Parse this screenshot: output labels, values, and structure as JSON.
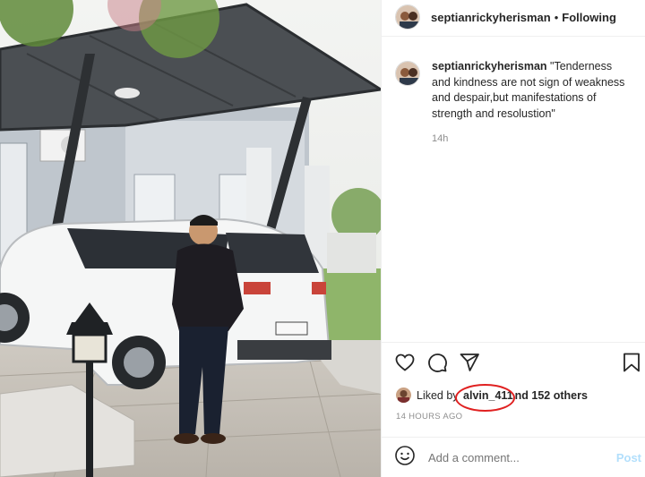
{
  "post": {
    "username": "septianrickyherisman",
    "separator": "•",
    "follow_status": "Following"
  },
  "caption": {
    "username": "septianrickyherisman",
    "text": "\"Tenderness and kindness are not sign of weakness and despair,but manifestations of strength and resolustion\"",
    "time": "14h"
  },
  "likes": {
    "prefix": "Liked by",
    "user": "alvin_411",
    "suffix": "nd 152 others"
  },
  "timestamp": "14 HOURS AGO",
  "comment": {
    "placeholder": "Add a comment...",
    "post_label": "Post"
  },
  "icons": {
    "like": "heart-icon",
    "comment": "comment-bubble-icon",
    "share": "paper-plane-icon",
    "save": "bookmark-icon",
    "emoji": "emoji-icon"
  },
  "colors": {
    "annotation_circle": "#e02020",
    "post_button": "#b2dffc",
    "secondary_text": "#8e8e8e"
  }
}
